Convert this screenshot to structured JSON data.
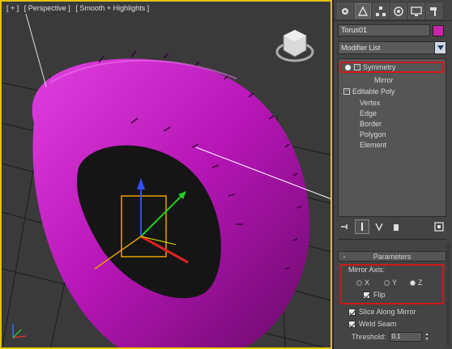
{
  "viewport": {
    "label_parts": [
      "[ + ]",
      "[ Perspective ]",
      "[ Smooth + Highlights ]"
    ],
    "object_color": "#cc22cc",
    "viewcube_icon": "viewcube-icon"
  },
  "command_panel": {
    "tabs": [
      {
        "name": "create",
        "icon": "gear-icon"
      },
      {
        "name": "modify",
        "icon": "modify-icon"
      },
      {
        "name": "hierarchy",
        "icon": "hierarchy-icon"
      },
      {
        "name": "motion",
        "icon": "motion-icon"
      },
      {
        "name": "display",
        "icon": "display-icon"
      },
      {
        "name": "utilities",
        "icon": "hammer-icon"
      }
    ],
    "object_name": "Torus01",
    "object_color": "#cc22aa",
    "modifier_list_label": "Modifier List",
    "stack": {
      "symmetry": "Symmetry",
      "mirror": "Mirror",
      "editable_poly": "Editable Poly",
      "sub_objects": [
        "Vertex",
        "Edge",
        "Border",
        "Polygon",
        "Element"
      ]
    },
    "parameters": {
      "rollout_minus": "-",
      "title": "Parameters",
      "mirror_axis_label": "Mirror Axis:",
      "axes": [
        "X",
        "Y",
        "Z"
      ],
      "selected_axis": "Z",
      "flip_label": "Flip",
      "flip_checked": true,
      "slice_label": "Slice Along Mirror",
      "slice_checked": true,
      "weld_label": "Weld Seam",
      "weld_checked": true,
      "threshold_label": "Threshold:",
      "threshold_value": "0.1"
    },
    "highlight_color": "#d01818"
  }
}
